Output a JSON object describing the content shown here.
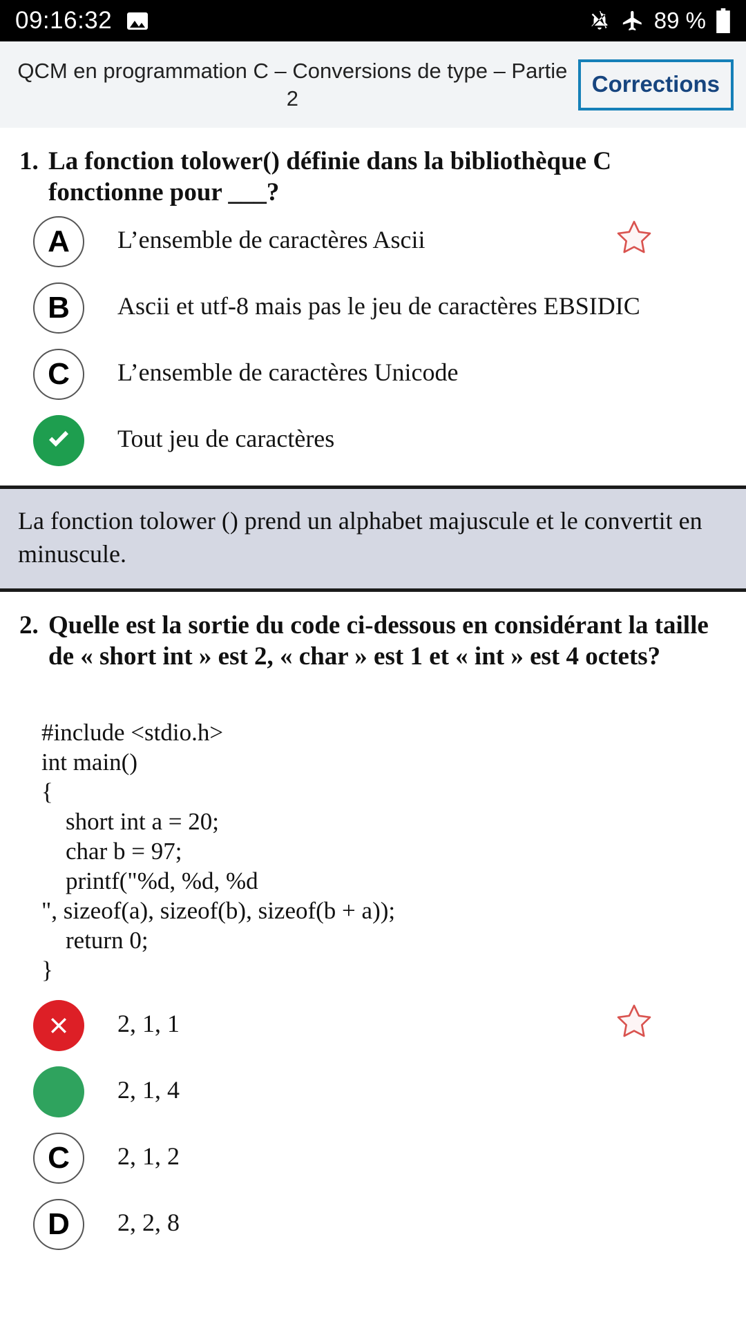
{
  "status_bar": {
    "time": "09:16:32",
    "image_icon": "image-icon",
    "bell_off_icon": "bell-off-icon",
    "airplane_icon": "airplane-mode-icon",
    "battery_percent": "89 %",
    "battery_icon": "battery-icon"
  },
  "header": {
    "title": "QCM en programmation C – Conversions de type – Partie 2",
    "corrections_label": "Corrections",
    "accent_border": "#1580b8",
    "accent_text": "#17457f",
    "background": "#f2f4f6"
  },
  "questions": [
    {
      "number": "1.",
      "text": "La fonction tolower() définie dans la bibliothèque C fonctionne pour ___?",
      "star_icon": "star-outline-icon",
      "options": [
        {
          "badge": "A",
          "state": "normal",
          "text": "L’ensemble de caractères Ascii"
        },
        {
          "badge": "B",
          "state": "normal",
          "text": "Ascii et utf-8 mais pas le jeu de caractères EBSIDIC"
        },
        {
          "badge": "C",
          "state": "normal",
          "text": "L’ensemble de caractères Unicode"
        },
        {
          "badge": "",
          "state": "correct",
          "text": "Tout jeu de caractères"
        }
      ],
      "explanation": "La fonction tolower () prend un alphabet majuscule et le convertit en minuscule."
    },
    {
      "number": "2.",
      "text": "Quelle est la sortie du code ci-dessous en considérant la taille de « short int » est 2, « char » est 1 et « int » est 4 octets?",
      "star_icon": "star-outline-icon",
      "code": "#include <stdio.h>\nint main()\n{\n    short int a = 20;\n    char b = 97;\n    printf(\"%d, %d, %d\n\", sizeof(a), sizeof(b), sizeof(b + a));\n    return 0;\n}",
      "options": [
        {
          "badge": "",
          "state": "wrong",
          "text": "2, 1, 1"
        },
        {
          "badge": "",
          "state": "correct-plain",
          "text": "2, 1, 4"
        },
        {
          "badge": "C",
          "state": "normal",
          "text": "2, 1, 2"
        },
        {
          "badge": "D",
          "state": "normal",
          "text": "2, 2, 8"
        }
      ]
    }
  ],
  "colors": {
    "correct_green": "#1e9e4f",
    "correct_plain_green": "#2fa35e",
    "wrong_red": "#dd1f26",
    "star_red": "#d9534f",
    "explanation_bg": "#d5d8e3"
  }
}
